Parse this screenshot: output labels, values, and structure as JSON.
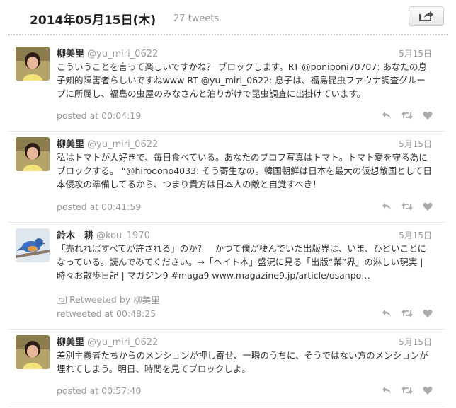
{
  "header": {
    "date": "2014年05月15日(木)",
    "count": "27 tweets",
    "share_icon": "share-icon"
  },
  "tweets": [
    {
      "name": "柳美里",
      "handle": "@yu_miri_0622",
      "date": "5月15日",
      "text": "こういうことを言って楽しいですかね？ ブロックします。RT @poniponi70707: あなたの息子知的障害者らしいですねwww RT @yu_miri_0622: 息子は、福島昆虫ファウナ調査グループに所属し、福島の虫屋のみなさんと泊りがけで昆虫調査に出掛けています。",
      "posted": "posted at 00:04:19"
    },
    {
      "name": "柳美里",
      "handle": "@yu_miri_0622",
      "date": "5月15日",
      "text": "私はトマトが大好きで、毎日食べている。あなたのプロフ写真はトマト。トマト愛を守る為にブロックする。 “@hirooono4033: そう寄生なの。韓国朝鮮は日本を最大の仮想敵国として日本侵攻の準備してるから、つまり貴方は日本人の敵と自覚すべき！",
      "posted": "posted at 00:41:59"
    },
    {
      "name": "鈴木　耕",
      "handle": "@kou_1970",
      "date": "5月15日",
      "text": "「売れればすべてが許される」のか？　かつて僕が棲んでいた出版界は、いま、ひどいことになっている。読んでみてください。→「ヘイト本」盛況に見る「出版“業”界」の淋しい現実 | 時々お散歩日記 | マガジン9 #maga9 www.magazine9.jp/article/osanpo…",
      "retweeted_by_label": "Retweeted by",
      "retweeted_by": "柳美里",
      "posted": "retweeted at 00:48:25"
    },
    {
      "name": "柳美里",
      "handle": "@yu_miri_0622",
      "date": "5月15日",
      "text": "差別主義者たちからのメンションが押し寄せ、一瞬のうちに、そうではない方のメンションが埋れてしまう。明日、時間を見てブロックしよ。",
      "posted": "posted at 00:57:40"
    }
  ]
}
